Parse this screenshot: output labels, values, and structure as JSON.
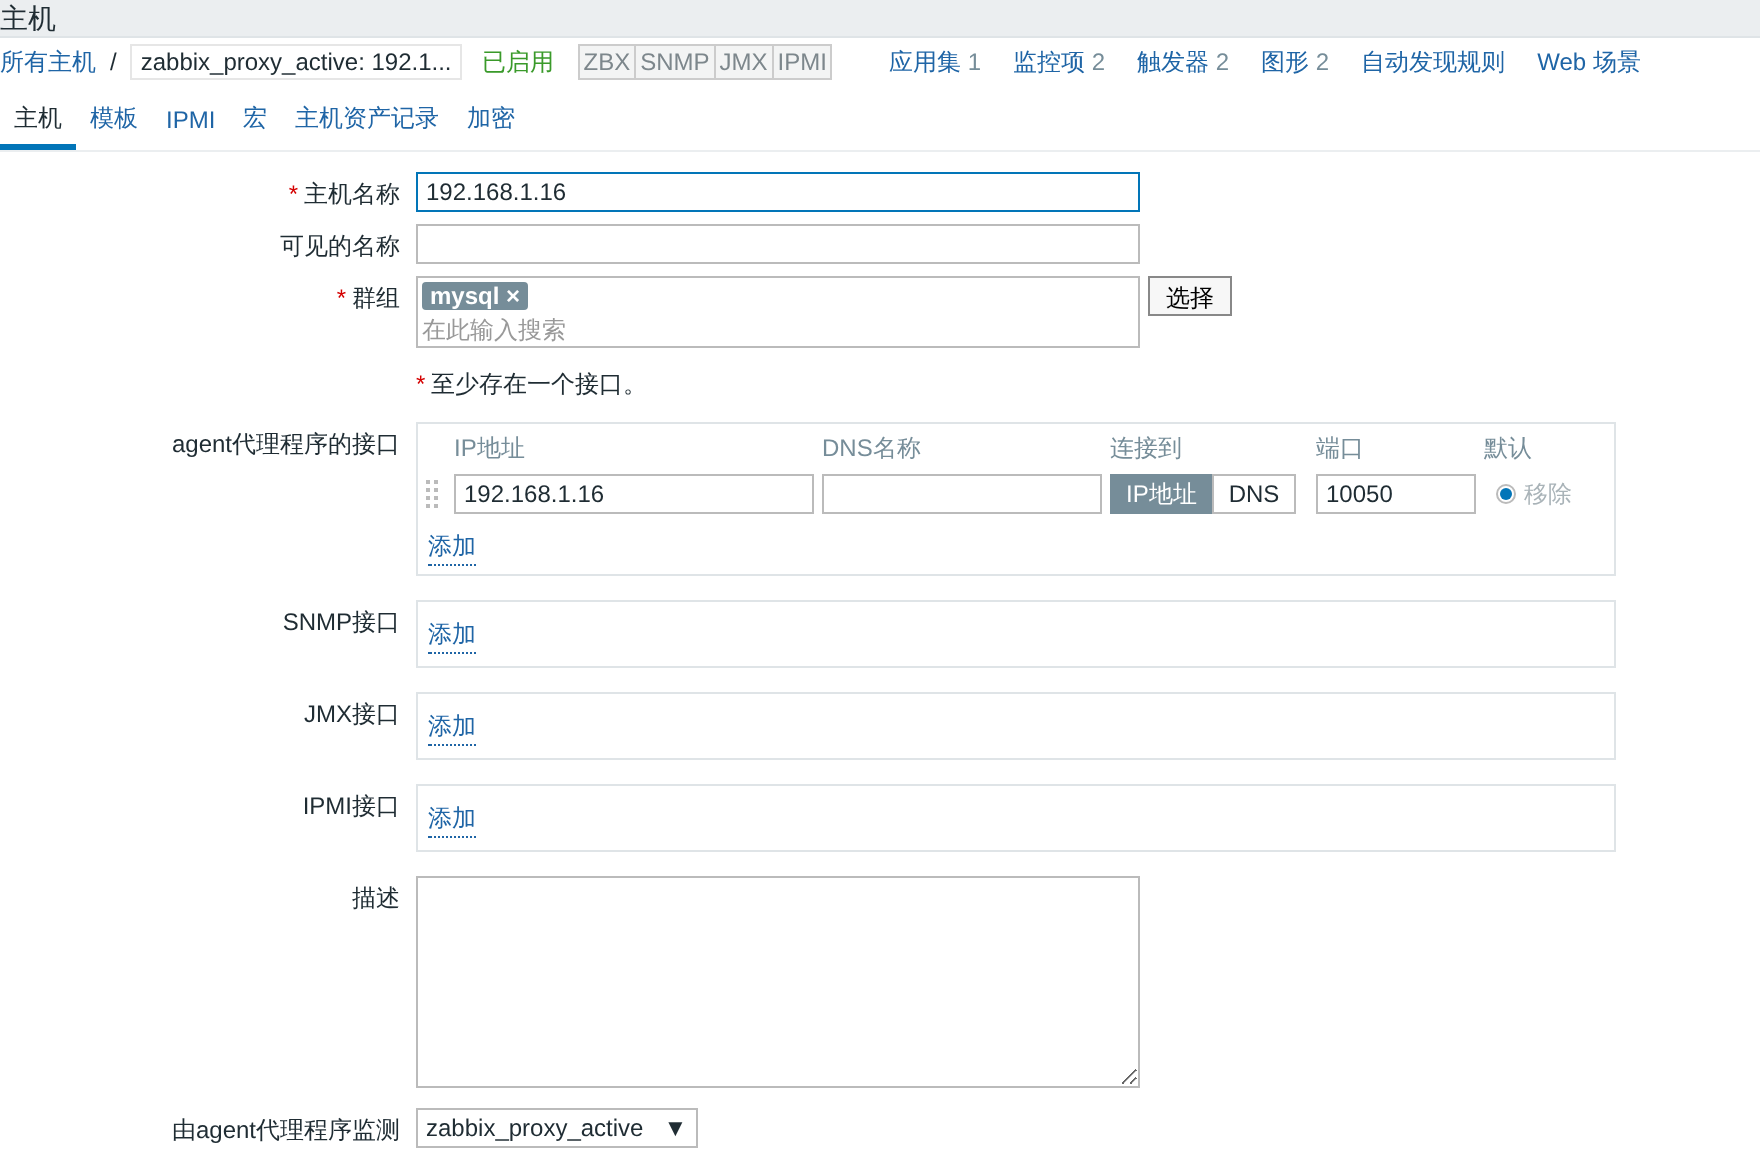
{
  "page_title": "主机",
  "breadcrumb": {
    "root": "所有主机",
    "separator": "/",
    "current": "zabbix_proxy_active: 192.1..."
  },
  "status": {
    "label": "已启用",
    "enabled": true
  },
  "availability": [
    {
      "label": "ZBX",
      "available": false
    },
    {
      "label": "SNMP",
      "available": false
    },
    {
      "label": "JMX",
      "available": false
    },
    {
      "label": "IPMI",
      "available": false
    }
  ],
  "nav_links": [
    {
      "label": "应用集",
      "count": "1"
    },
    {
      "label": "监控项",
      "count": "2"
    },
    {
      "label": "触发器",
      "count": "2"
    },
    {
      "label": "图形",
      "count": "2"
    },
    {
      "label": "自动发现规则"
    },
    {
      "label": "Web 场景"
    }
  ],
  "tabs": [
    {
      "label": "主机",
      "selected": true
    },
    {
      "label": "模板",
      "selected": false
    },
    {
      "label": "IPMI",
      "selected": false
    },
    {
      "label": "宏",
      "selected": false
    },
    {
      "label": "主机资产记录",
      "selected": false
    },
    {
      "label": "加密",
      "selected": false
    }
  ],
  "form": {
    "host_name": {
      "label": "主机名称",
      "required": true,
      "value": "192.168.1.16"
    },
    "visible_name": {
      "label": "可见的名称",
      "required": false
    },
    "groups": {
      "label": "群组",
      "required": true,
      "tags": [
        "mysql"
      ],
      "remove_glyph": "×",
      "placeholder": "在此输入搜索",
      "button": "选择"
    },
    "interface_note": {
      "mark": "*",
      "text": "至少存在一个接口。"
    },
    "agent_interfaces": {
      "label": "agent代理程序的接口",
      "columns": [
        "IP地址",
        "DNS名称",
        "连接到",
        "端口",
        "默认"
      ],
      "rows": [
        {
          "ip": "192.168.1.16",
          "connect_options": [
            {
              "label": "IP地址",
              "selected": true
            },
            {
              "label": "DNS",
              "selected": false
            }
          ],
          "port": "10050",
          "default": true,
          "remove": "移除"
        }
      ],
      "add": "添加"
    },
    "snmp_interfaces": {
      "label": "SNMP接口",
      "add": "添加"
    },
    "jmx_interfaces": {
      "label": "JMX接口",
      "add": "添加"
    },
    "ipmi_interfaces": {
      "label": "IPMI接口",
      "add": "添加"
    },
    "description": {
      "label": "描述"
    },
    "proxy": {
      "label": "由agent代理程序监测",
      "value": "zabbix_proxy_active",
      "arrow": "▼"
    }
  }
}
